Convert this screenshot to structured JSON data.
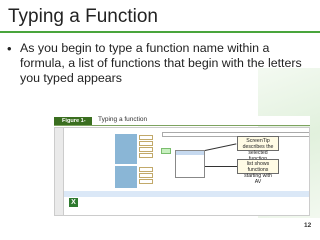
{
  "slide": {
    "title": "Typing a Function",
    "bullet": "As you begin to type a function name within a formula, a list of functions that begin with the letters you typed appears",
    "page_number": "12"
  },
  "figure": {
    "label": "Figure 1-12",
    "title": "Typing a function"
  },
  "callouts": {
    "screentip": "ScreenTip describes the selected function",
    "list": "list shows functions starting with AV"
  },
  "colors": {
    "accent_green": "#49a53c",
    "figure_label_bg": "#3a6e1f",
    "callout_bg": "#fffbe5"
  }
}
